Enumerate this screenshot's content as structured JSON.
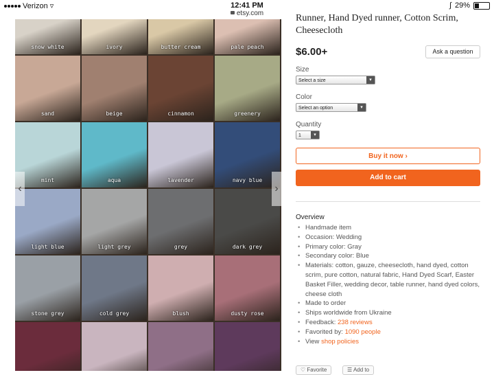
{
  "status_bar": {
    "carrier": "Verizon",
    "time": "12:41 PM",
    "battery": "29%",
    "battery_level": 0.29
  },
  "url": "etsy.com",
  "gallery": {
    "tiles": [
      {
        "label": "snow white",
        "color": "#d8d2c8"
      },
      {
        "label": "ivory",
        "color": "#e3d6bf"
      },
      {
        "label": "butter cream",
        "color": "#d9c8a6"
      },
      {
        "label": "pale peach",
        "color": "#dcbfb2"
      },
      {
        "label": "sand",
        "color": "#c8a896"
      },
      {
        "label": "beige",
        "color": "#a08070"
      },
      {
        "label": "cinnamon",
        "color": "#6b4434"
      },
      {
        "label": "greenery",
        "color": "#a7aa86"
      },
      {
        "label": "mint",
        "color": "#b9d6d8"
      },
      {
        "label": "aqua",
        "color": "#5fb9c9"
      },
      {
        "label": "lavender",
        "color": "#c9c6d6"
      },
      {
        "label": "navy blue",
        "color": "#334d79"
      },
      {
        "label": "light blue",
        "color": "#9aa9c6"
      },
      {
        "label": "light grey",
        "color": "#a5a6a6"
      },
      {
        "label": "grey",
        "color": "#6d6e70"
      },
      {
        "label": "dark grey",
        "color": "#4a4a48"
      },
      {
        "label": "stone grey",
        "color": "#9aa0a6"
      },
      {
        "label": "cold grey",
        "color": "#6f7888"
      },
      {
        "label": "blush",
        "color": "#cfaeb0"
      },
      {
        "label": "dusty rose",
        "color": "#a86f78"
      },
      {
        "label": "",
        "color": "#6b2c3c"
      },
      {
        "label": "",
        "color": "#c9b5bf"
      },
      {
        "label": "",
        "color": "#8f6f87"
      },
      {
        "label": "",
        "color": "#5e3a5c"
      }
    ]
  },
  "product": {
    "title": "Runner, Hand Dyed runner, Cotton Scrim, Cheesecloth",
    "price": "$6.00+",
    "ask_label": "Ask a question",
    "size_label": "Size",
    "size_value": "Select a size",
    "color_label": "Color",
    "color_value": "Select an option",
    "quantity_label": "Quantity",
    "quantity_value": "1",
    "buy_label": "Buy it now ›",
    "cart_label": "Add to cart",
    "accent_color": "#f1641e"
  },
  "overview": {
    "title": "Overview",
    "items": [
      "Handmade item",
      "Occasion: Wedding",
      "Primary color: Gray",
      "Secondary color: Blue",
      "Materials: cotton, gauze, cheesecloth, hand dyed, cotton scrim, pure cotton, natural fabric, Hand Dyed Scarf, Easter Basket Filler, wedding decor, table runner, hand dyed colors, cheese cloth",
      "Made to order",
      "Ships worldwide from Ukraine"
    ],
    "feedback_prefix": "Feedback: ",
    "feedback_link": "238 reviews",
    "favorited_prefix": "Favorited by: ",
    "favorited_link": "1090 people",
    "view_prefix": "View ",
    "view_link": "shop policies"
  },
  "bottom": {
    "favorite_label": "Favorite",
    "add_to_label": "Add to"
  }
}
